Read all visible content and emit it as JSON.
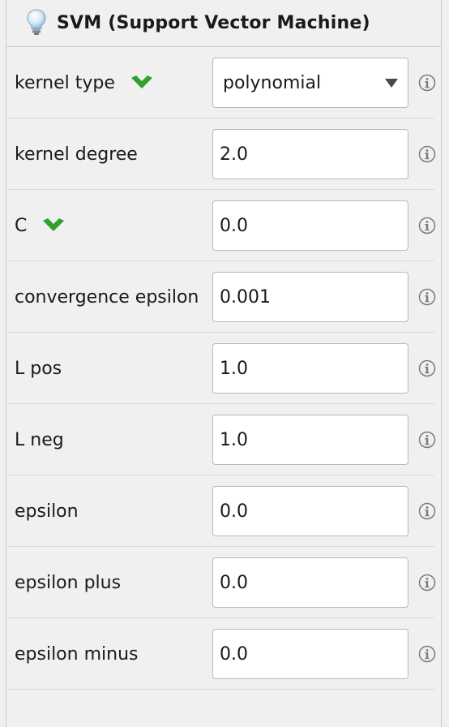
{
  "panel": {
    "title": "SVM (Support Vector Machine)",
    "header_icon": "lightbulb-icon"
  },
  "params": [
    {
      "label": "kernel type",
      "value": "polynomial",
      "kind": "select",
      "expert_toggle": true
    },
    {
      "label": "kernel degree",
      "value": "2.0",
      "kind": "input"
    },
    {
      "label": "C",
      "value": "0.0",
      "kind": "input",
      "expert_toggle": true
    },
    {
      "label": "convergence epsilon",
      "value": "0.001",
      "kind": "input"
    },
    {
      "label": "L pos",
      "value": "1.0",
      "kind": "input"
    },
    {
      "label": "L neg",
      "value": "1.0",
      "kind": "input"
    },
    {
      "label": "epsilon",
      "value": "0.0",
      "kind": "input"
    },
    {
      "label": "epsilon plus",
      "value": "0.0",
      "kind": "input"
    },
    {
      "label": "epsilon minus",
      "value": "0.0",
      "kind": "input"
    }
  ],
  "colors": {
    "chevron_green": "#2ea12e",
    "info_gray": "#7a7a7a"
  }
}
